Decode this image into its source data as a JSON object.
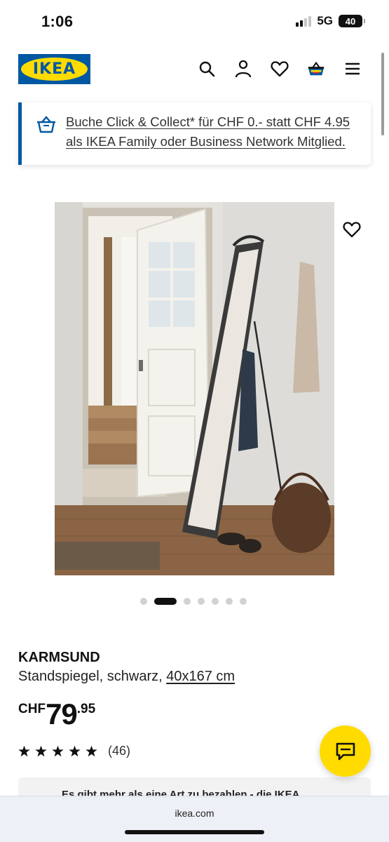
{
  "status_bar": {
    "time": "1:06",
    "network": "5G",
    "battery": "40"
  },
  "header": {
    "logo_text": "IKEA",
    "icons": [
      "search-icon",
      "account-icon",
      "heart-icon",
      "shopping-bag-icon",
      "menu-icon"
    ]
  },
  "banner": {
    "text": "Buche Click & Collect* für CHF 0.- statt CHF 4.95 als IKEA Family oder Business Network Mitglied.",
    "icon": "shopping-basket-icon"
  },
  "carousel": {
    "dot_count": 7,
    "active_index": 1
  },
  "product": {
    "name": "KARMSUND",
    "description": "Standspiegel, schwarz, ",
    "size": "40x167 cm",
    "price": {
      "currency": "CHF",
      "integer": "79",
      "decimal": ".95"
    },
    "rating": {
      "stars": 5,
      "count": "(46)"
    }
  },
  "info_card": {
    "text": "Es gibt mehr als eine Art zu bezahlen - die IKEA"
  },
  "browser": {
    "url": "ikea.com"
  },
  "colors": {
    "ikea_blue": "#0058a3",
    "ikea_yellow": "#ffdb00"
  }
}
